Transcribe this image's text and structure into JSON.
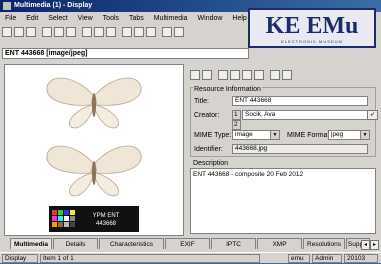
{
  "window": {
    "title": "Multimedia (1) - Display"
  },
  "menu": [
    "File",
    "Edit",
    "Select",
    "View",
    "Tools",
    "Tabs",
    "Multimedia",
    "Window",
    "Help"
  ],
  "logo": {
    "main": "KE EMu",
    "sub": "ELECTRONIC MUSEUM"
  },
  "record": {
    "title": "ENT 443668 [image/jpeg]"
  },
  "image": {
    "caption_line1": "YPM ENT",
    "caption_line2": "443668"
  },
  "resource": {
    "heading": "Resource Information",
    "title_label": "Title:",
    "title_value": "ENT 443668",
    "creator_label": "Creator:",
    "creator_index": "1",
    "creator_value": "Socik, Ava",
    "creator_next_index": "2",
    "mime_type_label": "MIME Type:",
    "mime_type_value": "image",
    "mime_format_label": "MIME Format:",
    "mime_format_value": "jpeg",
    "identifier_label": "Identifier:",
    "identifier_value": "443668.jpg"
  },
  "description": {
    "heading": "Description",
    "value": "ENT 443668 - composite 20 Feb 2012"
  },
  "tabs": [
    "Multimedia",
    "Details",
    "Characteristics",
    "EXIF",
    "IPTC",
    "XMP",
    "Resolutions",
    "Supple"
  ],
  "status": {
    "mode": "Display",
    "item": "Item 1 of 1",
    "locale": "emu",
    "user": "Admin",
    "number": "20103"
  }
}
